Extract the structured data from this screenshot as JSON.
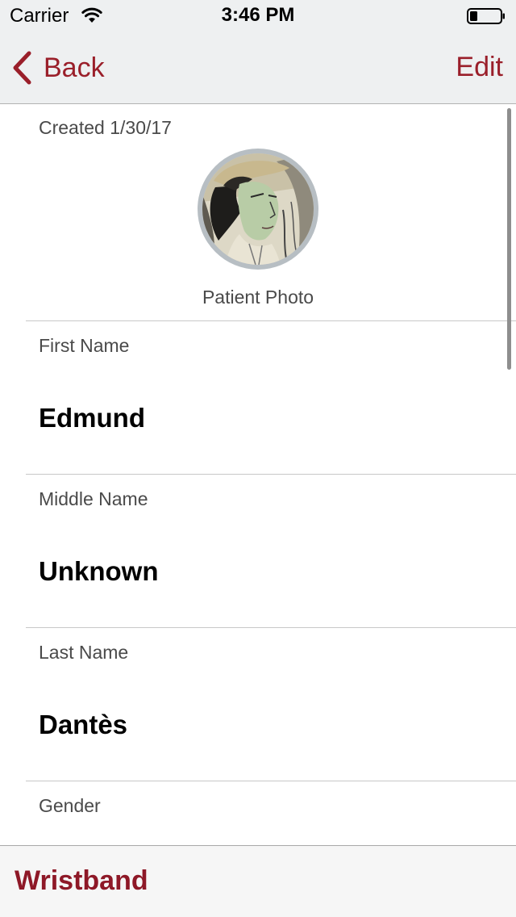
{
  "status_bar": {
    "carrier": "Carrier",
    "time": "3:46 PM",
    "wifi_icon": "wifi-icon",
    "battery_icon": "battery-icon",
    "battery_level": 0.25
  },
  "nav": {
    "back_label": "Back",
    "back_icon": "chevron-left-icon",
    "edit_label": "Edit"
  },
  "patient": {
    "created": "Created 1/30/17",
    "photo_caption": "Patient Photo",
    "fields": [
      {
        "label": "First Name",
        "value": "Edmund"
      },
      {
        "label": "Middle Name",
        "value": "Unknown"
      },
      {
        "label": "Last Name",
        "value": "Dantès"
      },
      {
        "label": "Gender",
        "value": ""
      }
    ]
  },
  "toolbar": {
    "wristband_label": "Wristband"
  },
  "colors": {
    "accent": "#9a1f2a",
    "nav_background": "#eef0f1",
    "label_text": "#4a4a4a",
    "value_text": "#000000"
  }
}
